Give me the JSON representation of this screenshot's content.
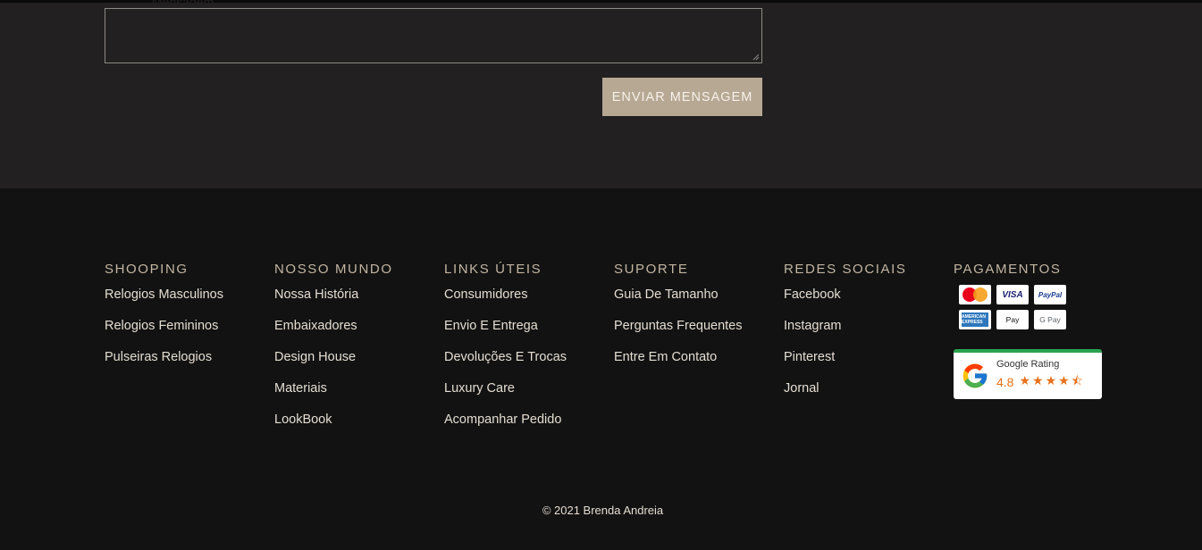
{
  "contact_form": {
    "message_label": "Mensagem",
    "message_value": "",
    "send_label": "ENVIAR MENSAGEM"
  },
  "footer": {
    "columns": [
      {
        "title": "SHOOPING",
        "links": [
          "Relogios Masculinos",
          "Relogios Femininos",
          "Pulseiras Relogios"
        ]
      },
      {
        "title": "NOSSO MUNDO",
        "links": [
          "Nossa História",
          "Embaixadores",
          "Design House",
          "Materiais",
          "LookBook"
        ]
      },
      {
        "title": "LINKS ÚTEIS",
        "links": [
          "Consumidores",
          "Envio E Entrega",
          "Devoluções E Trocas",
          "Luxury Care",
          "Acompanhar Pedido"
        ]
      },
      {
        "title": "SUPORTE",
        "links": [
          "Guia De Tamanho",
          "Perguntas Frequentes",
          "Entre Em Contato"
        ]
      },
      {
        "title": "REDES SOCIAIS",
        "links": [
          "Facebook",
          "Instagram",
          "Pinterest",
          "Jornal"
        ]
      }
    ],
    "payments": {
      "title": "PAGAMENTOS",
      "methods": [
        "mastercard",
        "visa",
        "paypal",
        "american-express",
        "apple-pay",
        "google-pay"
      ],
      "visa_label": "VISA",
      "paypal_label": "PayPal",
      "apple_label": " Pay",
      "gpay_label": "G Pay",
      "amex_label": "AMERICAN EXPRESS"
    },
    "google_rating": {
      "title": "Google Rating",
      "score": "4.8",
      "rating_value": 4.8,
      "max": 5,
      "stars": "★★★★⯪",
      "accent": "#e7711b"
    },
    "copyright": "© 2021 Brenda Andreia"
  },
  "colors": {
    "contact_bg": "#222021",
    "footer_bg": "#121212",
    "button_bg": "#b7a894",
    "heading": "#c2b5a2",
    "link": "#e4ddd2"
  }
}
